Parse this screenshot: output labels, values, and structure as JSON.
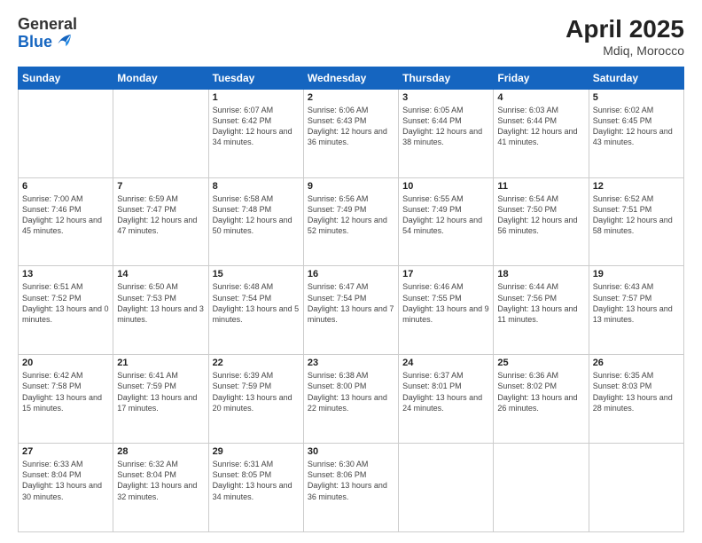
{
  "header": {
    "logo_general": "General",
    "logo_blue": "Blue",
    "title": "April 2025",
    "location": "Mdiq, Morocco"
  },
  "weekdays": [
    "Sunday",
    "Monday",
    "Tuesday",
    "Wednesday",
    "Thursday",
    "Friday",
    "Saturday"
  ],
  "weeks": [
    [
      {
        "day": "",
        "info": ""
      },
      {
        "day": "",
        "info": ""
      },
      {
        "day": "1",
        "info": "Sunrise: 6:07 AM\nSunset: 6:42 PM\nDaylight: 12 hours and 34 minutes."
      },
      {
        "day": "2",
        "info": "Sunrise: 6:06 AM\nSunset: 6:43 PM\nDaylight: 12 hours and 36 minutes."
      },
      {
        "day": "3",
        "info": "Sunrise: 6:05 AM\nSunset: 6:44 PM\nDaylight: 12 hours and 38 minutes."
      },
      {
        "day": "4",
        "info": "Sunrise: 6:03 AM\nSunset: 6:44 PM\nDaylight: 12 hours and 41 minutes."
      },
      {
        "day": "5",
        "info": "Sunrise: 6:02 AM\nSunset: 6:45 PM\nDaylight: 12 hours and 43 minutes."
      }
    ],
    [
      {
        "day": "6",
        "info": "Sunrise: 7:00 AM\nSunset: 7:46 PM\nDaylight: 12 hours and 45 minutes."
      },
      {
        "day": "7",
        "info": "Sunrise: 6:59 AM\nSunset: 7:47 PM\nDaylight: 12 hours and 47 minutes."
      },
      {
        "day": "8",
        "info": "Sunrise: 6:58 AM\nSunset: 7:48 PM\nDaylight: 12 hours and 50 minutes."
      },
      {
        "day": "9",
        "info": "Sunrise: 6:56 AM\nSunset: 7:49 PM\nDaylight: 12 hours and 52 minutes."
      },
      {
        "day": "10",
        "info": "Sunrise: 6:55 AM\nSunset: 7:49 PM\nDaylight: 12 hours and 54 minutes."
      },
      {
        "day": "11",
        "info": "Sunrise: 6:54 AM\nSunset: 7:50 PM\nDaylight: 12 hours and 56 minutes."
      },
      {
        "day": "12",
        "info": "Sunrise: 6:52 AM\nSunset: 7:51 PM\nDaylight: 12 hours and 58 minutes."
      }
    ],
    [
      {
        "day": "13",
        "info": "Sunrise: 6:51 AM\nSunset: 7:52 PM\nDaylight: 13 hours and 0 minutes."
      },
      {
        "day": "14",
        "info": "Sunrise: 6:50 AM\nSunset: 7:53 PM\nDaylight: 13 hours and 3 minutes."
      },
      {
        "day": "15",
        "info": "Sunrise: 6:48 AM\nSunset: 7:54 PM\nDaylight: 13 hours and 5 minutes."
      },
      {
        "day": "16",
        "info": "Sunrise: 6:47 AM\nSunset: 7:54 PM\nDaylight: 13 hours and 7 minutes."
      },
      {
        "day": "17",
        "info": "Sunrise: 6:46 AM\nSunset: 7:55 PM\nDaylight: 13 hours and 9 minutes."
      },
      {
        "day": "18",
        "info": "Sunrise: 6:44 AM\nSunset: 7:56 PM\nDaylight: 13 hours and 11 minutes."
      },
      {
        "day": "19",
        "info": "Sunrise: 6:43 AM\nSunset: 7:57 PM\nDaylight: 13 hours and 13 minutes."
      }
    ],
    [
      {
        "day": "20",
        "info": "Sunrise: 6:42 AM\nSunset: 7:58 PM\nDaylight: 13 hours and 15 minutes."
      },
      {
        "day": "21",
        "info": "Sunrise: 6:41 AM\nSunset: 7:59 PM\nDaylight: 13 hours and 17 minutes."
      },
      {
        "day": "22",
        "info": "Sunrise: 6:39 AM\nSunset: 7:59 PM\nDaylight: 13 hours and 20 minutes."
      },
      {
        "day": "23",
        "info": "Sunrise: 6:38 AM\nSunset: 8:00 PM\nDaylight: 13 hours and 22 minutes."
      },
      {
        "day": "24",
        "info": "Sunrise: 6:37 AM\nSunset: 8:01 PM\nDaylight: 13 hours and 24 minutes."
      },
      {
        "day": "25",
        "info": "Sunrise: 6:36 AM\nSunset: 8:02 PM\nDaylight: 13 hours and 26 minutes."
      },
      {
        "day": "26",
        "info": "Sunrise: 6:35 AM\nSunset: 8:03 PM\nDaylight: 13 hours and 28 minutes."
      }
    ],
    [
      {
        "day": "27",
        "info": "Sunrise: 6:33 AM\nSunset: 8:04 PM\nDaylight: 13 hours and 30 minutes."
      },
      {
        "day": "28",
        "info": "Sunrise: 6:32 AM\nSunset: 8:04 PM\nDaylight: 13 hours and 32 minutes."
      },
      {
        "day": "29",
        "info": "Sunrise: 6:31 AM\nSunset: 8:05 PM\nDaylight: 13 hours and 34 minutes."
      },
      {
        "day": "30",
        "info": "Sunrise: 6:30 AM\nSunset: 8:06 PM\nDaylight: 13 hours and 36 minutes."
      },
      {
        "day": "",
        "info": ""
      },
      {
        "day": "",
        "info": ""
      },
      {
        "day": "",
        "info": ""
      }
    ]
  ]
}
